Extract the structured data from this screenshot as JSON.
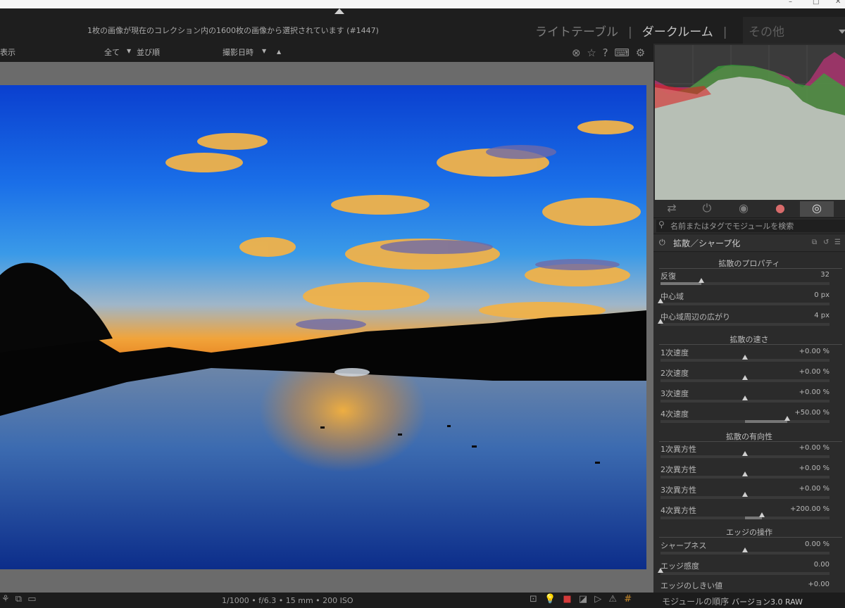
{
  "window": {
    "minimize": "–",
    "maximize": "□",
    "close": "✕"
  },
  "header": {
    "collection_info": "1枚の画像が現在のコレクション内の1600枚の画像から選択されています (#1447)",
    "views": [
      "ライトテーブル",
      "ダークルーム",
      "その他"
    ],
    "view_separator": "|"
  },
  "filterbar": {
    "show_label": "表示",
    "filter_value": "全て",
    "sort_label": "並び順",
    "sort_value": "撮影日時",
    "tri_down": "▼",
    "tri_up": "▲"
  },
  "top_icons": {
    "overlay": "⊗",
    "star": "☆",
    "help": "?",
    "keyboard": "⌨",
    "settings": "⚙"
  },
  "module_groups": [
    "⇄",
    "⏻",
    "◉",
    "●",
    "◎"
  ],
  "search": {
    "placeholder": "名前またはタグでモジュールを検索",
    "icon": "⚲"
  },
  "module": {
    "title": "拡散／シャープ化",
    "power_icon": "⏻",
    "icons": [
      "⧉",
      "↺",
      "☰"
    ]
  },
  "sections": [
    {
      "label": "拡散のプロパティ"
    },
    {
      "label": "拡散の速さ"
    },
    {
      "label": "拡散の有向性"
    },
    {
      "label": "エッジの操作"
    }
  ],
  "sliders": [
    {
      "label": "反復",
      "value": "32",
      "fraction": 0.24
    },
    {
      "label": "中心域",
      "value": "0 px",
      "fraction": 0.0
    },
    {
      "label": "中心域周辺の広がり",
      "value": "4 px",
      "fraction": 0.0
    },
    {
      "label": "1次速度",
      "value": "+0.00 %",
      "fraction": 0.5
    },
    {
      "label": "2次速度",
      "value": "+0.00 %",
      "fraction": 0.5
    },
    {
      "label": "3次速度",
      "value": "+0.00 %",
      "fraction": 0.5
    },
    {
      "label": "4次速度",
      "value": "+50.00 %",
      "fraction": 0.75
    },
    {
      "label": "1次異方性",
      "value": "+0.00 %",
      "fraction": 0.5
    },
    {
      "label": "2次異方性",
      "value": "+0.00 %",
      "fraction": 0.5
    },
    {
      "label": "3次異方性",
      "value": "+0.00 %",
      "fraction": 0.5
    },
    {
      "label": "4次異方性",
      "value": "+200.00 %",
      "fraction": 0.6
    },
    {
      "label": "シャープネス",
      "value": "0.00 %",
      "fraction": 0.5
    },
    {
      "label": "エッジ感度",
      "value": "0.00",
      "fraction": 0.0
    },
    {
      "label": "エッジのしきい値",
      "value": "+0.00",
      "fraction": 0.0
    }
  ],
  "bottombar": {
    "left_icons": [
      "⚘",
      "⧉",
      "▭"
    ],
    "exif": "1/1000 • f/6.3 • 15 mm • 200 ISO",
    "icons": [
      "⊡",
      "💡",
      "■",
      "◪",
      "▷",
      "⚠",
      "#"
    ],
    "module_order_label": "モジュールの順序",
    "module_order_value": "バージョン3.0 RAW"
  }
}
